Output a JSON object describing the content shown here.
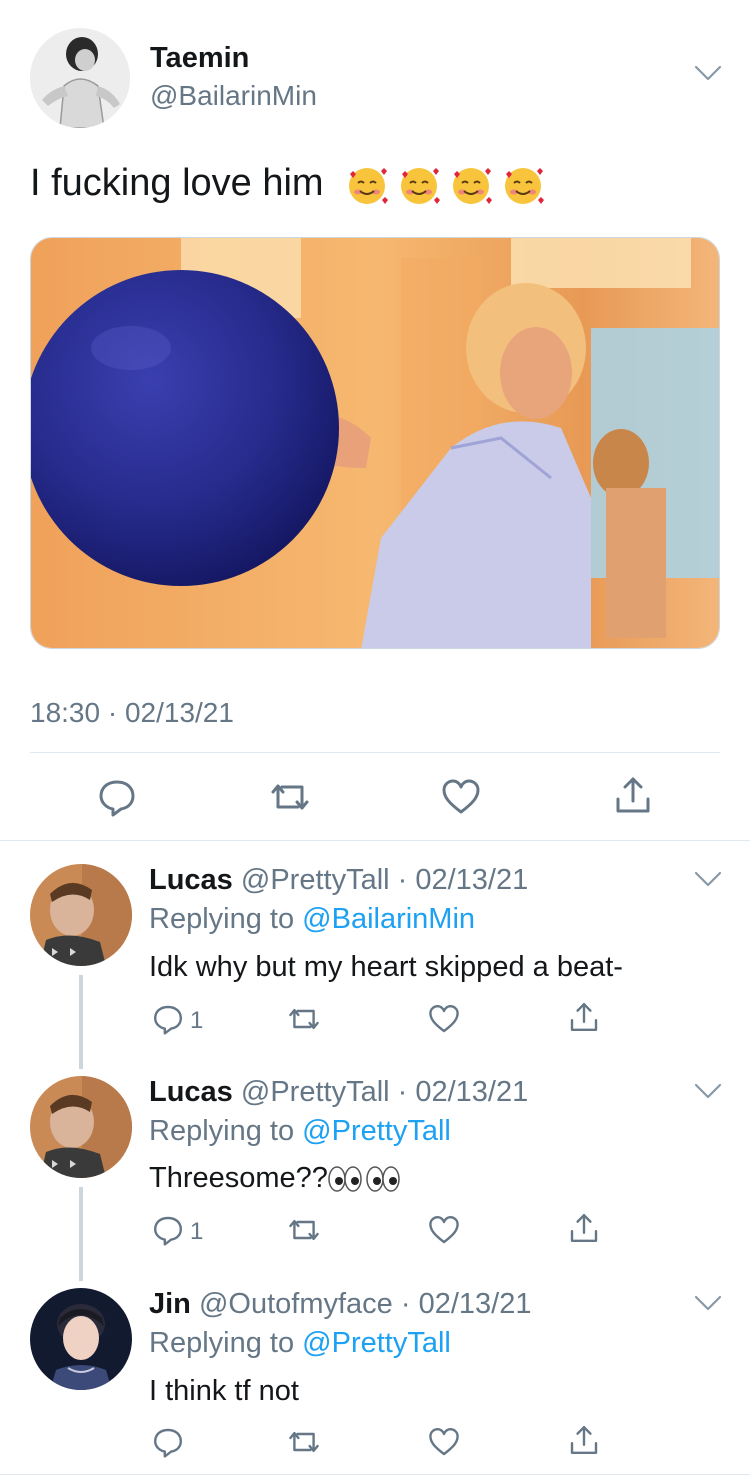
{
  "main_tweet": {
    "name": "Taemin",
    "handle": "@BailarinMin",
    "text": "I fucking love him",
    "emoji": [
      "smiling-face-with-hearts",
      "smiling-face-with-hearts",
      "smiling-face-with-hearts",
      "smiling-face-with-hearts"
    ],
    "timestamp": "18:30 · 02/13/21",
    "image_description_icon": "photo"
  },
  "replies": [
    {
      "name": "Lucas",
      "meta": "@PrettyTall · 02/13/21",
      "replying_prefix": "Replying to",
      "replying_to": "@BailarinMin",
      "text": "Idk why but my heart skipped a beat-",
      "reply_count": "1"
    },
    {
      "name": "Lucas",
      "meta": "@PrettyTall · 02/13/21",
      "replying_prefix": "Replying to",
      "replying_to": "@PrettyTall",
      "text": "Threesome??",
      "text_emoji": [
        "eyes",
        "eyes"
      ],
      "reply_count": "1"
    },
    {
      "name": "Jin",
      "meta": "@Outofmyface · 02/13/21",
      "replying_prefix": "Replying to",
      "replying_to": "@PrettyTall",
      "text": "I think tf not",
      "reply_count": ""
    }
  ],
  "colors": {
    "text": "#14171a",
    "secondary": "#657786",
    "link": "#1da1f2",
    "divider": "#e1e8ed"
  }
}
